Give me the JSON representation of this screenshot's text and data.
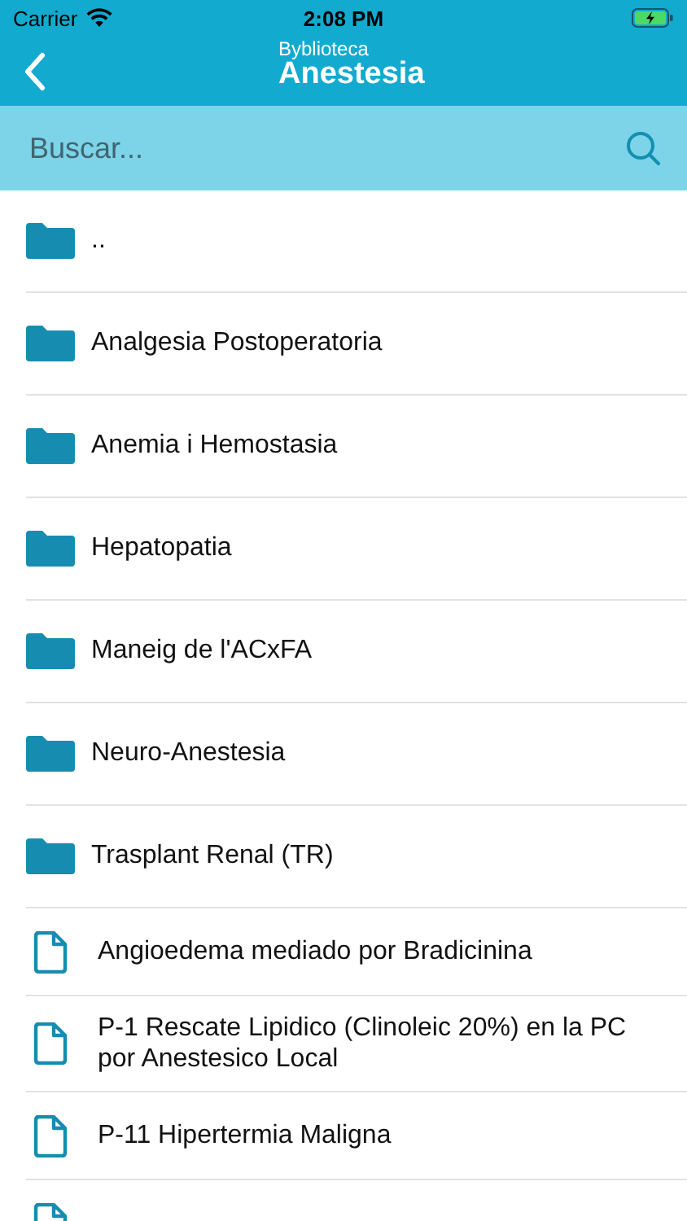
{
  "status_bar": {
    "carrier": "Carrier",
    "time": "2:08 PM"
  },
  "nav": {
    "subtitle": "Byblioteca",
    "title": "Anestesia"
  },
  "search": {
    "placeholder": "Buscar..."
  },
  "items": [
    {
      "kind": "folder",
      "label": ".."
    },
    {
      "kind": "folder",
      "label": "Analgesia Postoperatoria"
    },
    {
      "kind": "folder",
      "label": "Anemia i Hemostasia"
    },
    {
      "kind": "folder",
      "label": "Hepatopatia"
    },
    {
      "kind": "folder",
      "label": "Maneig de l'ACxFA"
    },
    {
      "kind": "folder",
      "label": "Neuro-Anestesia"
    },
    {
      "kind": "folder",
      "label": "Trasplant Renal (TR)"
    },
    {
      "kind": "file",
      "label": "Angioedema mediado por Bradicinina"
    },
    {
      "kind": "file",
      "label": "P-1 Rescate Lipidico (Clinoleic 20%) en la PC por Anestesico Local"
    },
    {
      "kind": "file",
      "label": "P-11 Hipertermia Maligna"
    },
    {
      "kind": "file"
    }
  ]
}
